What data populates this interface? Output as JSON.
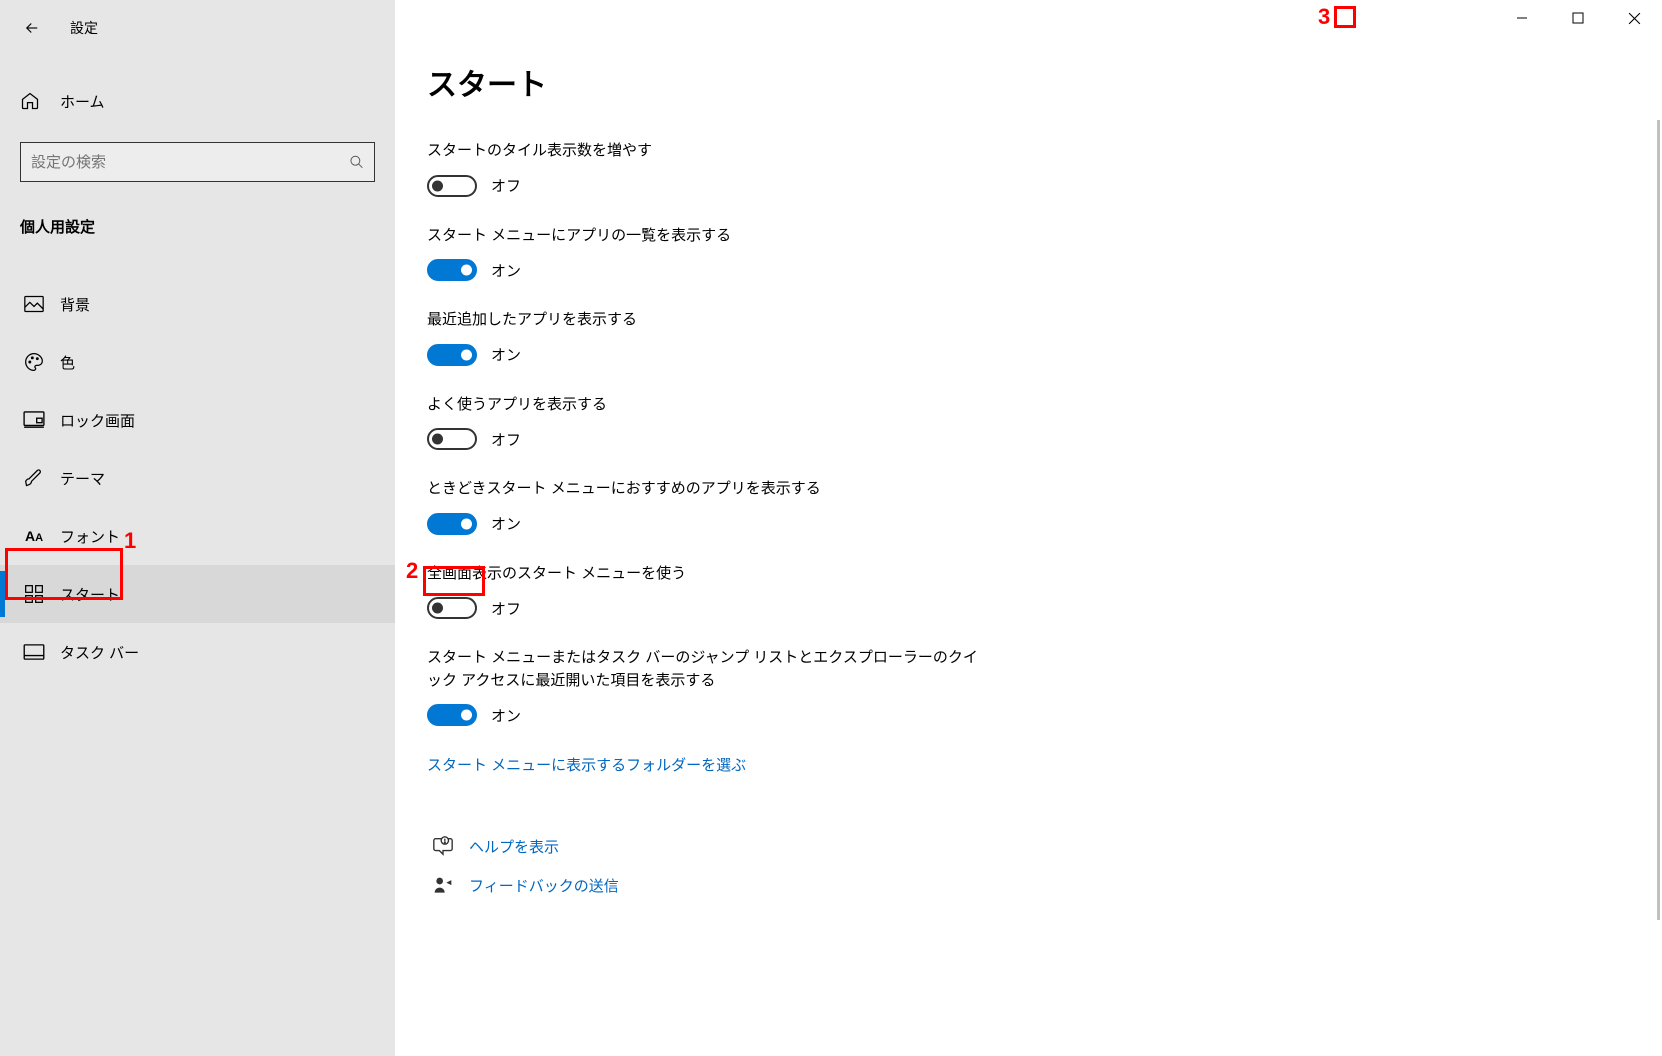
{
  "window": {
    "title": "設定"
  },
  "sidebar": {
    "home_label": "ホーム",
    "search_placeholder": "設定の検索",
    "category": "個人用設定",
    "items": [
      {
        "label": "背景"
      },
      {
        "label": "色"
      },
      {
        "label": "ロック画面"
      },
      {
        "label": "テーマ"
      },
      {
        "label": "フォント"
      },
      {
        "label": "スタート"
      },
      {
        "label": "タスク バー"
      }
    ]
  },
  "page": {
    "title": "スタート",
    "settings": [
      {
        "label": "スタートのタイル表示数を増やす",
        "state": "off",
        "state_text": "オフ"
      },
      {
        "label": "スタート メニューにアプリの一覧を表示する",
        "state": "on",
        "state_text": "オン"
      },
      {
        "label": "最近追加したアプリを表示する",
        "state": "on",
        "state_text": "オン"
      },
      {
        "label": "よく使うアプリを表示する",
        "state": "off",
        "state_text": "オフ"
      },
      {
        "label": "ときどきスタート メニューにおすすめのアプリを表示する",
        "state": "on",
        "state_text": "オン"
      },
      {
        "label": "全画面表示のスタート メニューを使う",
        "state": "off",
        "state_text": "オフ"
      },
      {
        "label": "スタート メニューまたはタスク バーのジャンプ リストとエクスプローラーのクイック アクセスに最近開いた項目を表示する",
        "state": "on",
        "state_text": "オン"
      }
    ],
    "folder_link": "スタート メニューに表示するフォルダーを選ぶ",
    "help_link": "ヘルプを表示",
    "feedback_link": "フィードバックの送信"
  },
  "annotations": {
    "n1": "1",
    "n2": "2",
    "n3": "3"
  }
}
